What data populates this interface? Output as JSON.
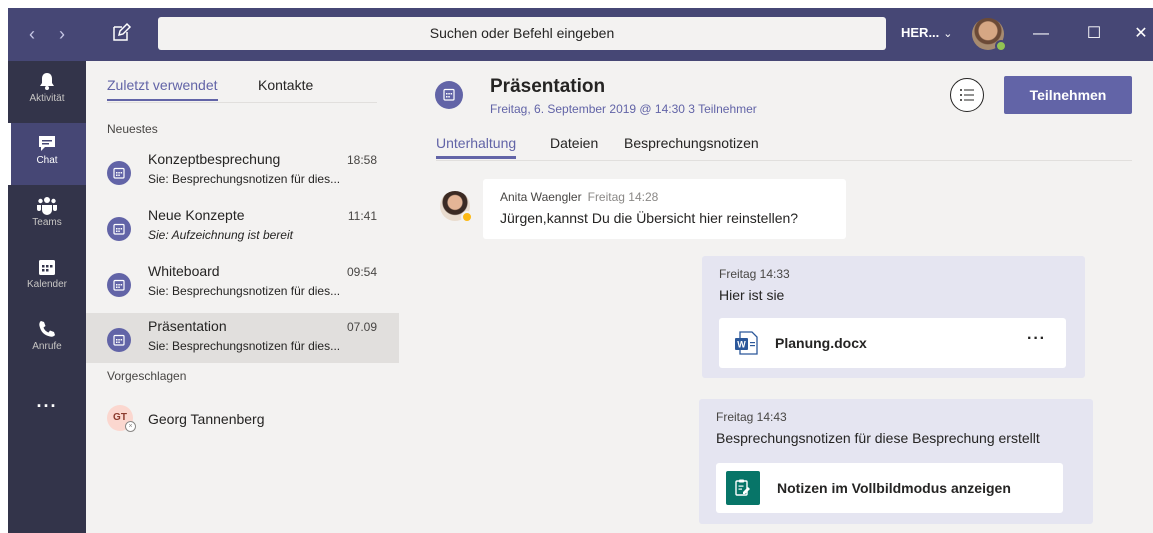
{
  "search": {
    "placeholder": "Suchen oder Befehl eingeben"
  },
  "account": {
    "tenant": "HER...",
    "chevron": "⌄"
  },
  "window": {
    "minimize": "—",
    "maximize": "☐",
    "close": "✕"
  },
  "rail": {
    "items": [
      {
        "label": "Aktivität",
        "icon": "bell-icon"
      },
      {
        "label": "Chat",
        "icon": "chat-icon"
      },
      {
        "label": "Teams",
        "icon": "teams-icon"
      },
      {
        "label": "Kalender",
        "icon": "calendar-icon"
      },
      {
        "label": "Anrufe",
        "icon": "phone-icon"
      }
    ],
    "more": "..."
  },
  "list": {
    "tabs": [
      "Zuletzt verwendet",
      "Kontakte"
    ],
    "recent_label": "Neuestes",
    "chats": [
      {
        "title": "Konzeptbesprechung",
        "time": "18:58",
        "preview": "Sie: Besprechungsnotizen für dies..."
      },
      {
        "title": "Neue Konzepte",
        "time": "11:41",
        "preview": "Sie: Aufzeichnung ist bereit"
      },
      {
        "title": "Whiteboard",
        "time": "09:54",
        "preview": "Sie: Besprechungsnotizen für dies..."
      },
      {
        "title": "Präsentation",
        "time": "07.09",
        "preview": "Sie: Besprechungsnotizen für dies..."
      }
    ],
    "suggested_label": "Vorgeschlagen",
    "suggested": [
      {
        "initials": "GT",
        "name": "Georg Tannenberg"
      }
    ]
  },
  "conversation": {
    "title": "Präsentation",
    "meta": "Freitag, 6. September 2019 @ 14:30 3 Teilnehmer",
    "join_label": "Teilnehmen",
    "tabs": [
      "Unterhaltung",
      "Dateien",
      "Besprechungsnotizen"
    ],
    "messages": [
      {
        "sender": "Anita Waengler",
        "time": "Freitag 14:28",
        "text": "Jürgen,kannst Du die Übersicht hier reinstellen?"
      },
      {
        "time": "Freitag 14:33",
        "text": "Hier ist sie",
        "attachment": "Planung.docx",
        "attachment_more": "···"
      },
      {
        "time": "Freitag 14:43",
        "text": "Besprechungsnotizen für diese Besprechung erstellt",
        "card": "Notizen im Vollbildmodus anzeigen"
      }
    ]
  },
  "colors": {
    "brand": "#6264a7",
    "titlebar": "#464775",
    "rail": "#33344a",
    "notes": "#077568"
  }
}
